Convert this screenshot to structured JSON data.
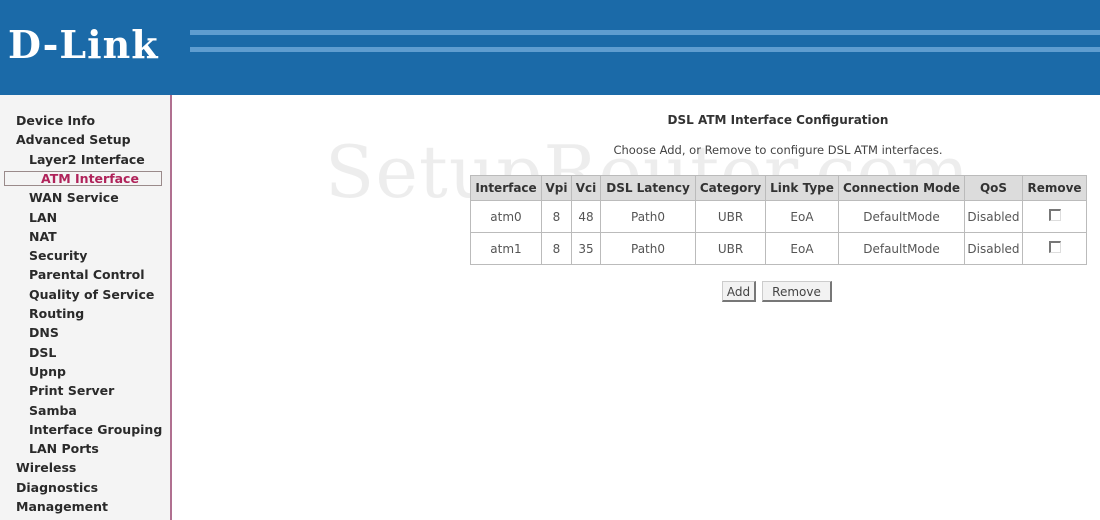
{
  "header": {
    "logo_text": "D-Link",
    "brand_color": "#1b6aa8"
  },
  "watermark": "SetupRouter.com",
  "sidebar": {
    "items": [
      {
        "label": "Device Info",
        "level": 0
      },
      {
        "label": "Advanced Setup",
        "level": 0
      },
      {
        "label": "Layer2 Interface",
        "level": 1
      },
      {
        "label": "ATM Interface",
        "level": 2,
        "active": true
      },
      {
        "label": "WAN Service",
        "level": 1
      },
      {
        "label": "LAN",
        "level": 1
      },
      {
        "label": "NAT",
        "level": 1
      },
      {
        "label": "Security",
        "level": 1
      },
      {
        "label": "Parental Control",
        "level": 1
      },
      {
        "label": "Quality of Service",
        "level": 1
      },
      {
        "label": "Routing",
        "level": 1
      },
      {
        "label": "DNS",
        "level": 1
      },
      {
        "label": "DSL",
        "level": 1
      },
      {
        "label": "Upnp",
        "level": 1
      },
      {
        "label": "Print Server",
        "level": 1
      },
      {
        "label": "Samba",
        "level": 1
      },
      {
        "label": "Interface Grouping",
        "level": 1
      },
      {
        "label": "LAN Ports",
        "level": 1
      },
      {
        "label": "Wireless",
        "level": 0
      },
      {
        "label": "Diagnostics",
        "level": 0
      },
      {
        "label": "Management",
        "level": 0
      }
    ]
  },
  "main": {
    "title": "DSL ATM Interface Configuration",
    "subtitle": "Choose Add, or Remove to configure DSL ATM interfaces.",
    "table": {
      "columns": [
        "Interface",
        "Vpi",
        "Vci",
        "DSL Latency",
        "Category",
        "Link Type",
        "Connection Mode",
        "QoS",
        "Remove"
      ],
      "rows": [
        [
          "atm0",
          "8",
          "48",
          "Path0",
          "UBR",
          "EoA",
          "DefaultMode",
          "Disabled",
          false
        ],
        [
          "atm1",
          "8",
          "35",
          "Path0",
          "UBR",
          "EoA",
          "DefaultMode",
          "Disabled",
          false
        ]
      ]
    },
    "add_label": "Add",
    "remove_label": "Remove"
  }
}
